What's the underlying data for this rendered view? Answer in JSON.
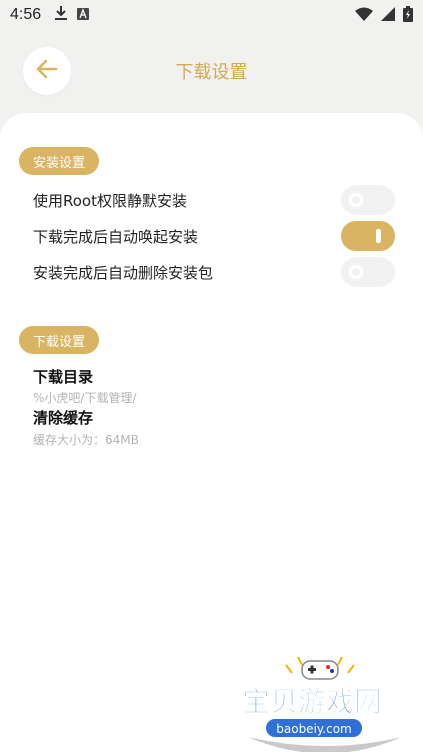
{
  "status_bar": {
    "time": "4:56",
    "icons": [
      "download-icon",
      "font-a-icon",
      "wifi-icon",
      "signal-icon",
      "battery-charging-icon"
    ]
  },
  "header": {
    "title": "下载设置",
    "back_icon": "arrow-left-icon"
  },
  "install_section": {
    "badge": "安装设置",
    "items": [
      {
        "label": "使用Root权限静默安装",
        "on": false
      },
      {
        "label": "下载完成后自动唤起安装",
        "on": true
      },
      {
        "label": "安装完成后自动删除安装包",
        "on": false
      }
    ]
  },
  "download_section": {
    "badge": "下载设置",
    "directory_title": "下载目录",
    "directory_path": "%小虎吧/下载管理/",
    "cache_title": "清除缓存",
    "cache_size": "缓存大小为：64MB"
  },
  "watermark": {
    "text": "宝贝游戏网",
    "url": "baobeiy.com"
  },
  "colors": {
    "accent": "#d9b463",
    "title": "#d2a955",
    "background": "#f1f1ef"
  }
}
